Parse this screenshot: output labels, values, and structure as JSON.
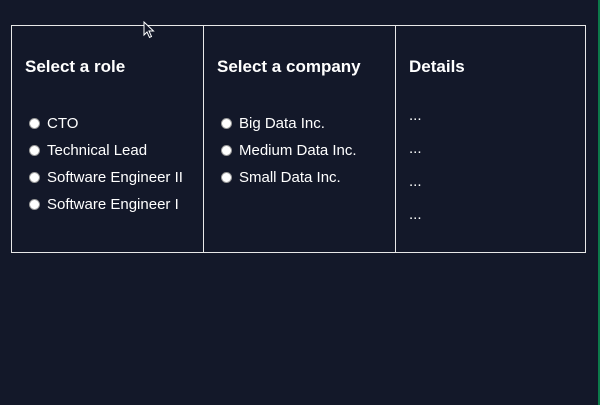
{
  "roles": {
    "heading": "Select a role",
    "options": [
      "CTO",
      "Technical Lead",
      "Software Engineer II",
      "Software Engineer I"
    ]
  },
  "companies": {
    "heading": "Select a company",
    "options": [
      "Big Data Inc.",
      "Medium Data Inc.",
      "Small Data Inc."
    ]
  },
  "details": {
    "heading": "Details",
    "lines": [
      "...",
      "...",
      "...",
      "..."
    ]
  },
  "colors": {
    "background": "#131829",
    "border": "#e8e8e8",
    "text": "#ffffff",
    "edge_accent": "#0c7a4a"
  },
  "icons": {
    "cursor": "mouse-pointer-icon"
  }
}
